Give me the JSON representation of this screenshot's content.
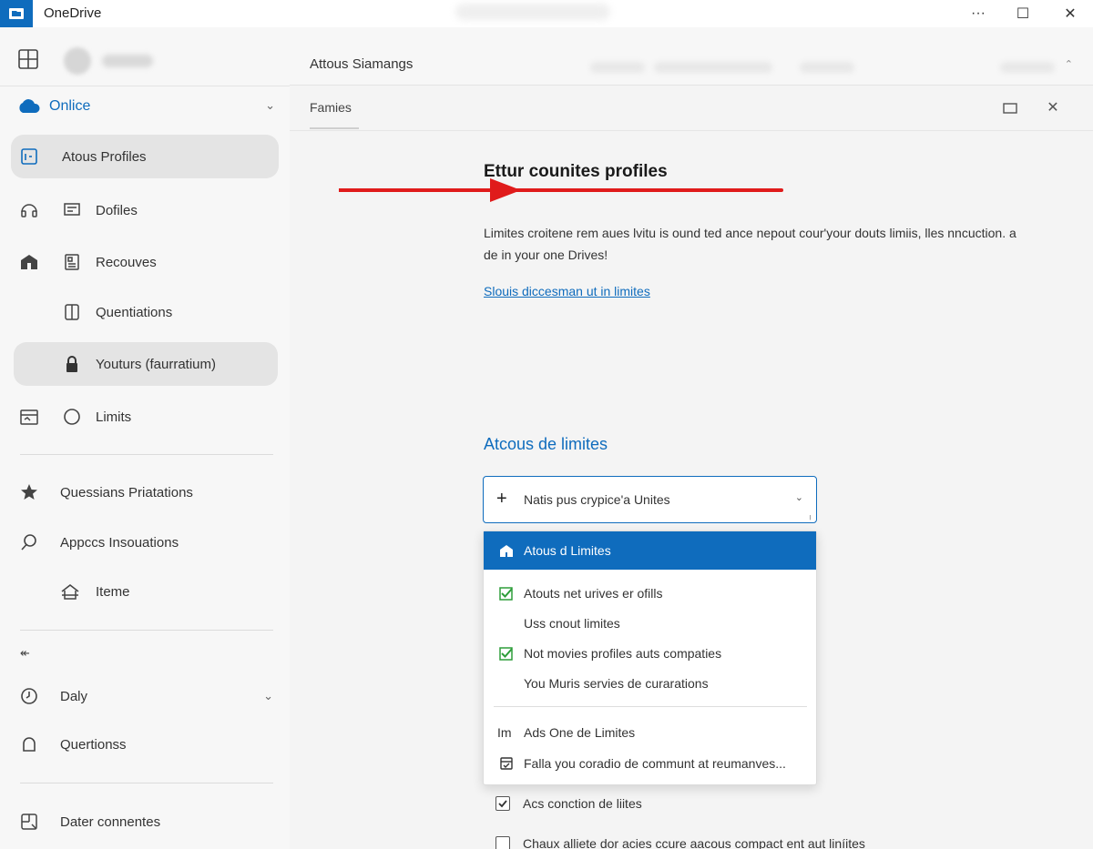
{
  "window": {
    "app_title": "OneDrive",
    "controls": {
      "minimize": "···",
      "maximize": "☐",
      "close": "✕"
    }
  },
  "sidebar": {
    "account_label": "Onlice",
    "account_chevron": "⌄",
    "items": [
      {
        "label": "Atous Profiles",
        "icon": "profile-card-icon",
        "selected": true
      },
      {
        "label": "Dofiles",
        "lead_icon": "headset-icon",
        "icon": "note-icon"
      },
      {
        "label": "Recouves",
        "lead_icon": "building-icon",
        "icon": "document-icon"
      },
      {
        "label": "Quentiations",
        "icon": "panel-icon"
      },
      {
        "label": "Youturs (faurratium)",
        "icon": "lock-icon",
        "selected": true
      },
      {
        "label": "Limits",
        "lead_icon": "calendar-icon",
        "icon": "circle-icon"
      }
    ],
    "section2": [
      {
        "label": "Quessians Priatations",
        "icon": "star-icon"
      },
      {
        "label": "Appccs Insouations",
        "icon": "search-icon"
      },
      {
        "label": "Iteme",
        "icon": "home-icon"
      }
    ],
    "lead_glyph": "↞",
    "section3": [
      {
        "label": "Daly",
        "icon": "clock-icon",
        "chevron": "⌄"
      },
      {
        "label": "Quertionss",
        "icon": "bell-icon"
      }
    ],
    "section4": [
      {
        "label": "Dater connentes",
        "icon": "page-icon"
      }
    ]
  },
  "main": {
    "header_tab": "Attous Siamangs",
    "header_caret": "⌃",
    "sub_tab": "Famies",
    "panel_close": "✕",
    "heading": "Ettur counites profiles",
    "description": "Limites croitene rem aues lvitu is ound ted ance nepout cour'your douts limiis, lles nncuction. a de in your one Drives!",
    "link": "Slouis diccesman ut in limites",
    "options_heading": "Atcous de limites",
    "combo": {
      "plus": "+",
      "value": "Natis pus crypice'a Unites",
      "caret": "⌄",
      "resize": "╷"
    },
    "dropdown": [
      {
        "label": "Atous d Limites",
        "icon": "building-icon",
        "highlight": true
      },
      {
        "label": "Atouts net urives er ofills",
        "icon": "check-icon"
      },
      {
        "label": "Uss cnout limites"
      },
      {
        "label": "Not movies profiles auts compaties",
        "icon": "check-icon"
      },
      {
        "label": "You Muris servies de curarations"
      },
      {
        "label": "Ads One de Limites",
        "prefix": "Im"
      },
      {
        "label": "Falla you coradio de communt at reumanves...",
        "icon": "calendar-icon"
      }
    ],
    "checkboxes": [
      {
        "label": "Acs conction de liites",
        "checked": true
      },
      {
        "label": "Chaux alliete dor acies ccure aacous compact ent aut liníites",
        "checked": false
      }
    ]
  },
  "colors": {
    "accent": "#0f6cbd",
    "annotation_red": "#e01b1b",
    "check_green": "#2e9d3a"
  }
}
